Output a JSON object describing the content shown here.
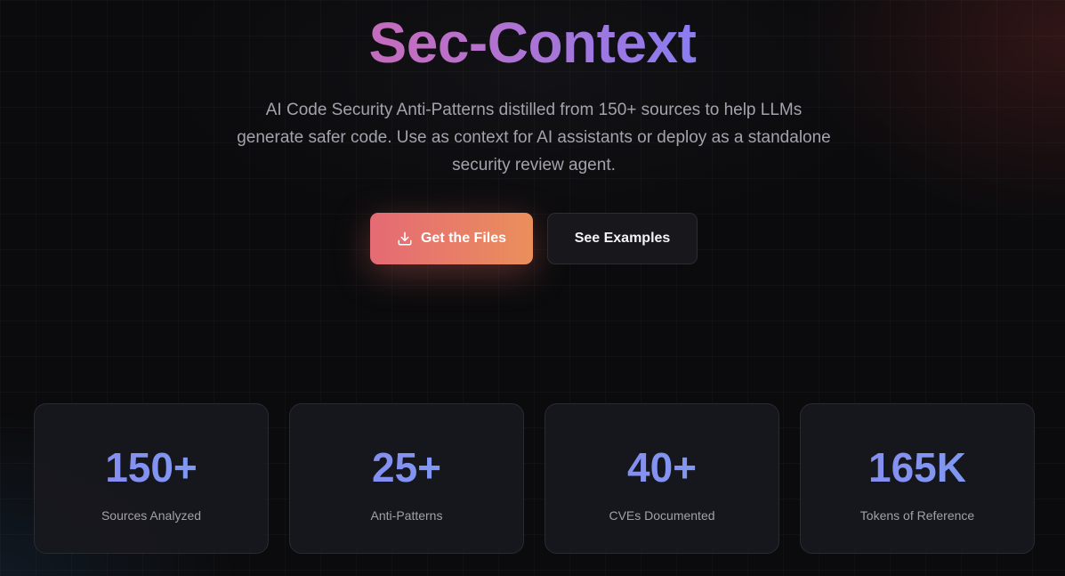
{
  "hero": {
    "title": "Sec-Context",
    "subtitle": "AI Code Security Anti-Patterns distilled from 150+ sources to help LLMs generate safer code. Use as context for AI assistants or deploy as a standalone security review agent."
  },
  "actions": {
    "primary_label": "Get the Files",
    "primary_icon": "download-icon",
    "secondary_label": "See Examples"
  },
  "stats": [
    {
      "value": "150+",
      "label": "Sources Analyzed"
    },
    {
      "value": "25+",
      "label": "Anti-Patterns"
    },
    {
      "value": "40+",
      "label": "CVEs Documented"
    },
    {
      "value": "165K",
      "label": "Tokens of Reference"
    }
  ],
  "colors": {
    "background": "#0b0b0d",
    "primary_gradient_start": "#e56a74",
    "primary_gradient_end": "#ea8f5c",
    "stat_accent": "#7f8ff2"
  }
}
